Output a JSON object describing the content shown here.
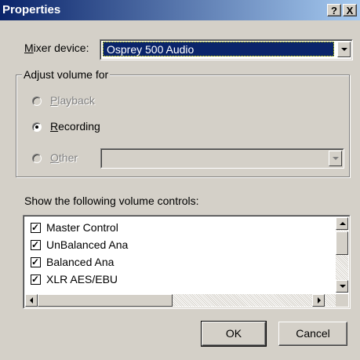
{
  "window": {
    "title": "Properties",
    "help_label": "?",
    "close_label": "X"
  },
  "mixer": {
    "label_mnemonic": "M",
    "label_rest": "ixer device:",
    "selected": "Osprey 500 Audio"
  },
  "adjust": {
    "title": "Adjust volume for",
    "options": [
      {
        "mnemonic": "P",
        "rest": "layback",
        "selected": false,
        "enabled": false
      },
      {
        "mnemonic": "R",
        "rest": "ecording",
        "selected": true,
        "enabled": true
      },
      {
        "mnemonic": "O",
        "rest": "ther",
        "selected": false,
        "enabled": false
      }
    ],
    "other_value": ""
  },
  "controls": {
    "label": "Show the following volume controls:",
    "items": [
      {
        "label": "Master Control",
        "checked": true
      },
      {
        "label": "UnBalanced Ana",
        "checked": true
      },
      {
        "label": "Balanced Ana",
        "checked": true
      },
      {
        "label": "XLR AES/EBU",
        "checked": true
      }
    ]
  },
  "buttons": {
    "ok": "OK",
    "cancel": "Cancel"
  },
  "colors": {
    "title_start": "#0a246a",
    "title_end": "#a6caf0",
    "face": "#d4d0c8",
    "selection": "#0a246a"
  }
}
